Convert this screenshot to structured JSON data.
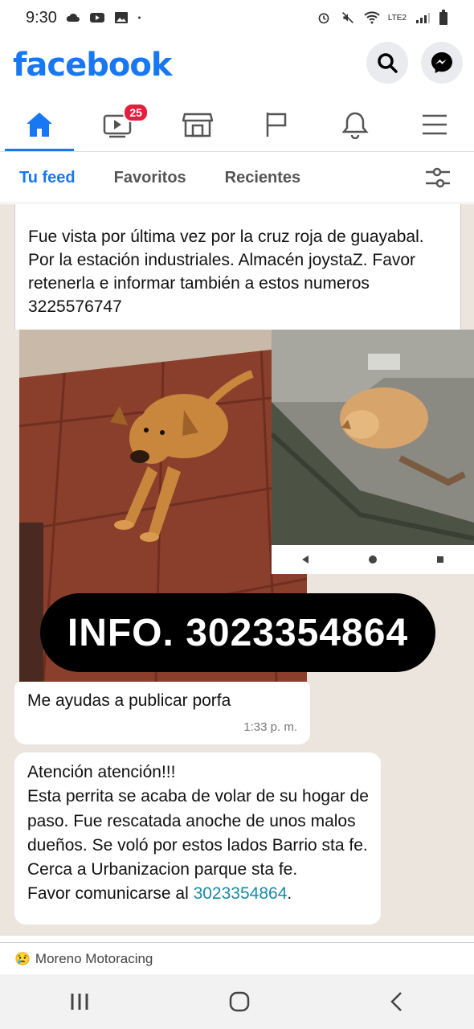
{
  "status_bar": {
    "time": "9:30",
    "network_label": "LTE2"
  },
  "header": {
    "brand": "facebook"
  },
  "nav": {
    "video_badge": "25"
  },
  "tabs": [
    "Tu feed",
    "Favoritos",
    "Recientes"
  ],
  "post": {
    "caption": "Fue vista por última vez por la cruz roja de guayabal. Por la estación industriales. Almacén joystaZ. Favor retenerla e informar también a estos numeros 3225576747",
    "info_overlay": "INFO. 3023354864",
    "message1": {
      "text": "Me ayudas a publicar porfa",
      "time": "1:33 p. m."
    },
    "message2": {
      "text": "Atención atención!!!\nEsta perrita se acaba de volar de su hogar de paso. Fue rescatada anoche de unos malos dueños. Se voló por estos lados Barrio sta fe. Cerca a Urbanizacion parque sta fe.\nFavor comunicarse al ",
      "phone": "3023354864",
      "end": "."
    }
  },
  "next_post": {
    "emoji": "😢",
    "author": "Moreno Motoracing"
  },
  "colors": {
    "brand": "#1877f2",
    "badge": "#e41e3f",
    "chat_bg": "#ebe5de"
  }
}
